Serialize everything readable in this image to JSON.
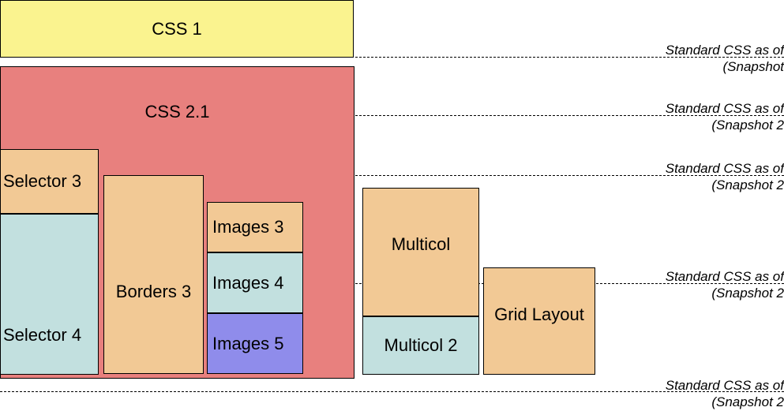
{
  "colors": {
    "yellow": "#faf38f",
    "red": "#e8807e",
    "orange": "#f2c995",
    "teal": "#c2e0df",
    "purple": "#8f8ceb"
  },
  "blocks": {
    "css1": "CSS 1",
    "css21": "CSS 2.1",
    "selector3": "Selector 3",
    "selector4": "Selector 4",
    "borders3": "Borders 3",
    "images3": "Images 3",
    "images4": "Images 4",
    "images5": "Images 5",
    "multicol": "Multicol",
    "multicol2": "Multicol 2",
    "gridlayout": "Grid Layout"
  },
  "notes": {
    "n1_line1": "Standard CSS as of",
    "n1_line2": "(Snapshot",
    "n2_line1": "Standard CSS as of",
    "n2_line2": "(Snapshot 2",
    "n3_line1": "Standard CSS as of",
    "n3_line2": "(Snapshot 2",
    "n4_line1": "Standard CSS as of",
    "n4_line2": "(Snapshot 2",
    "n5_line1": "Standard CSS as of",
    "n5_line2": "(Snapshot 2"
  }
}
